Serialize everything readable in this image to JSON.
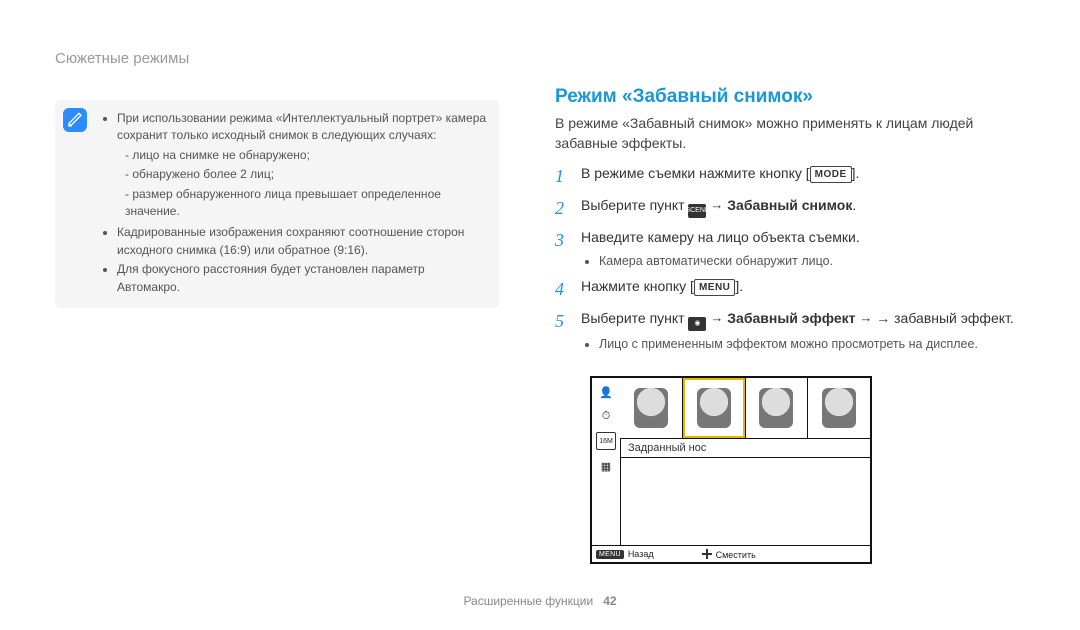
{
  "header": {
    "title": "Сюжетные режимы"
  },
  "note": {
    "items": [
      {
        "text": "При использовании режима «Интеллектуальный портрет» камера сохранит только исходный снимок в следующих случаях:",
        "sub": [
          "лицо на снимке не обнаружено;",
          "обнаружено более 2 лиц;",
          "размер обнаруженного лица превышает определенное значение."
        ]
      },
      {
        "text": "Кадрированные изображения сохраняют соотношение сторон исходного снимка (16:9) или обратное (9:16)."
      },
      {
        "text": "Для фокусного расстояния будет установлен параметр Автомакро."
      }
    ]
  },
  "section": {
    "title": "Режим «Забавный снимок»",
    "intro": "В режиме «Забавный снимок» можно применять к лицам людей забавные эффекты.",
    "steps": {
      "s1_a": "В режиме съемки нажмите кнопку [",
      "s1_b": "].",
      "mode_badge": "MODE",
      "s2_a": "Выберите пункт ",
      "s2_bold": "Забавный снимок",
      "s2_b": ".",
      "s3": "Наведите камеру на лицо объекта съемки.",
      "s3_bullet": "Камера автоматически обнаружит лицо.",
      "s4_a": "Нажмите кнопку [",
      "s4_b": "].",
      "menu_badge": "MENU",
      "s5_a": "Выберите пункт ",
      "s5_bold": "Забавный эффект",
      "s5_b": " → забавный эффект.",
      "s5_bullet": "Лицо с примененным эффектом можно просмотреть на дисплее."
    }
  },
  "camera_ui": {
    "effect_label": "Задранный нос",
    "back": "Назад",
    "move": "Сместить",
    "size_badge": "16M"
  },
  "footer": {
    "text": "Расширенные функции",
    "page": "42"
  },
  "chart_data": null
}
